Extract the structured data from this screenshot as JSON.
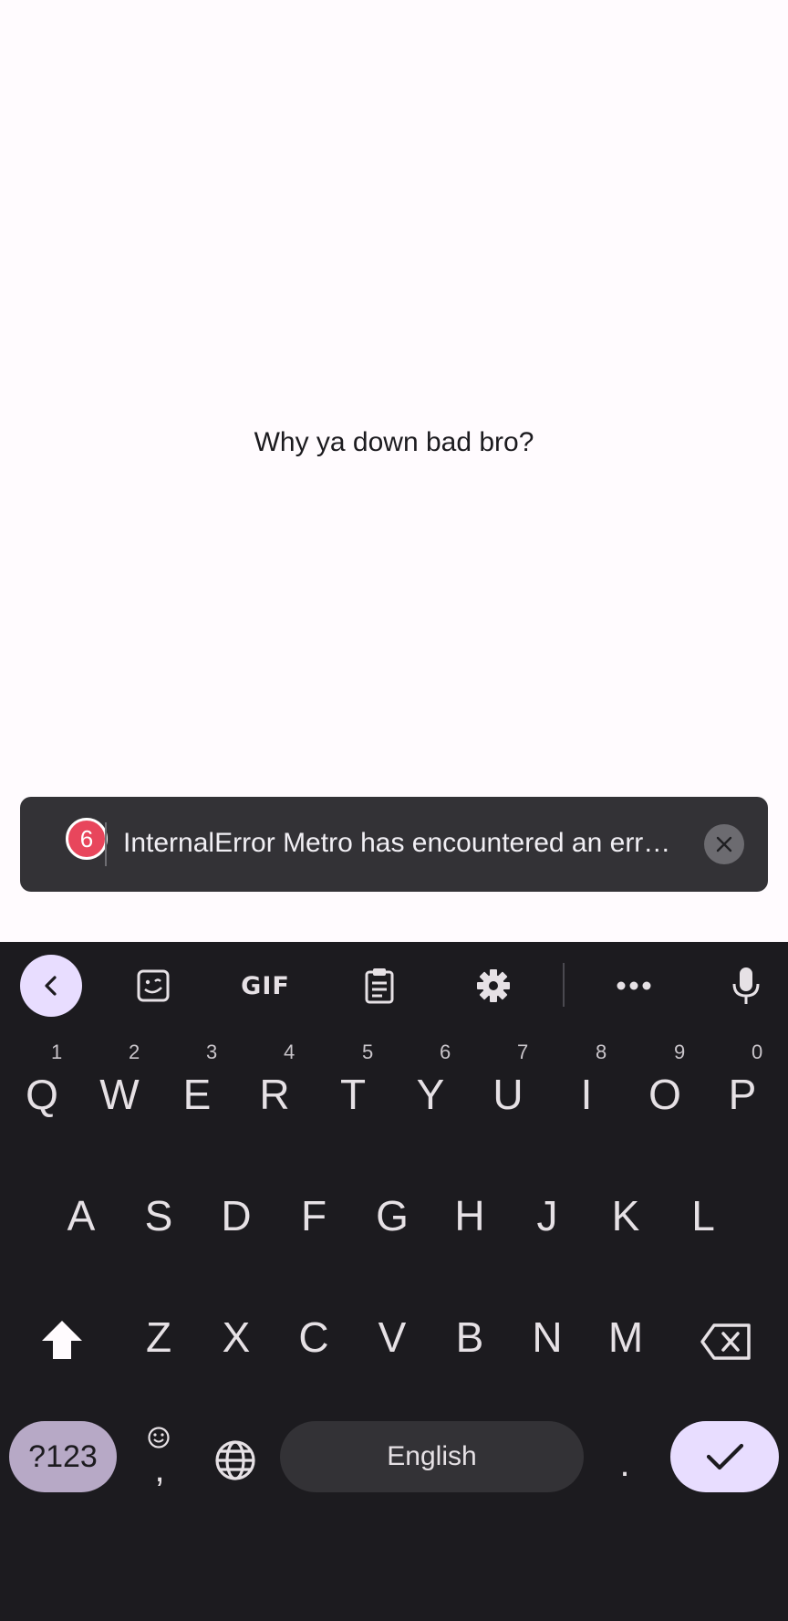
{
  "app": {
    "center_text": "Why ya down bad bro?"
  },
  "toast": {
    "badge": "6",
    "message": "InternalError Metro has encountered an err…"
  },
  "keyboard": {
    "toolbar": {
      "gif_label": "GIF",
      "icons": [
        "chevron-left-icon",
        "sticker-icon",
        "gif-icon",
        "clipboard-icon",
        "gear-icon",
        "more-icon",
        "mic-icon"
      ]
    },
    "row1": [
      {
        "label": "Q",
        "hint": "1"
      },
      {
        "label": "W",
        "hint": "2"
      },
      {
        "label": "E",
        "hint": "3"
      },
      {
        "label": "R",
        "hint": "4"
      },
      {
        "label": "T",
        "hint": "5"
      },
      {
        "label": "Y",
        "hint": "6"
      },
      {
        "label": "U",
        "hint": "7"
      },
      {
        "label": "I",
        "hint": "8"
      },
      {
        "label": "O",
        "hint": "9"
      },
      {
        "label": "P",
        "hint": "0"
      }
    ],
    "row2": [
      "A",
      "S",
      "D",
      "F",
      "G",
      "H",
      "J",
      "K",
      "L"
    ],
    "row3": [
      "Z",
      "X",
      "C",
      "V",
      "B",
      "N",
      "M"
    ],
    "bottom": {
      "symbols": "?123",
      "comma": ",",
      "space": "English",
      "period": "."
    },
    "colors": {
      "background": "#1c1b1f",
      "accent": "#e8ddff",
      "symbols_key": "#b7a9c6"
    }
  }
}
